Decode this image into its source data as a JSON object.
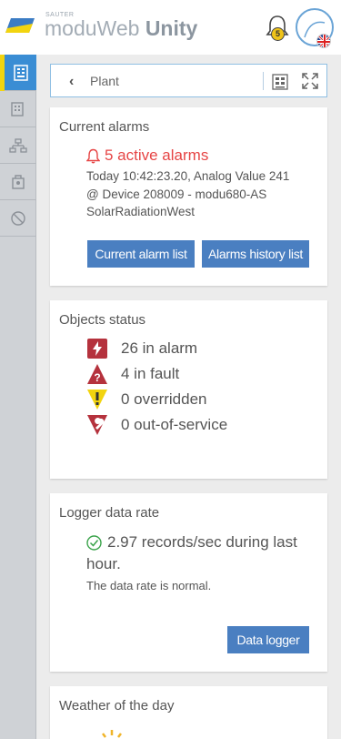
{
  "header": {
    "brand_small": "SAUTER",
    "brand_light": "moduWeb",
    "brand_bold": "Unity",
    "notification_count": "5",
    "colors": {
      "accent": "#3a8dd4",
      "badge": "#f0c419"
    }
  },
  "sidebar": {
    "items": [
      {
        "icon": "building-list-icon",
        "active": true
      },
      {
        "icon": "building-objects-icon"
      },
      {
        "icon": "hierarchy-icon"
      },
      {
        "icon": "device-icon"
      },
      {
        "icon": "disabled-objects-icon"
      }
    ]
  },
  "breadcrumb": {
    "label": "Plant"
  },
  "current_alarms": {
    "title": "Current alarms",
    "active_count_text": "5 active alarms",
    "detail_line1": "Today 10:42:23.20, Analog Value 241",
    "detail_line2": "@ Device 208009 - modu680-AS",
    "detail_line3": "SolarRadiationWest",
    "btn_current": "Current alarm list",
    "btn_history": "Alarms history list"
  },
  "objects_status": {
    "title": "Objects status",
    "rows": [
      {
        "text": "26 in alarm",
        "icon": "alarm-bolt-icon"
      },
      {
        "text": "4 in fault",
        "icon": "fault-question-icon"
      },
      {
        "text": "0 overridden",
        "icon": "overridden-exclamation-icon"
      },
      {
        "text": "0 out-of-service",
        "icon": "out-of-service-wrench-icon"
      }
    ]
  },
  "logger": {
    "title": "Logger data rate",
    "rate_text": "2.97 records/sec during last hour.",
    "status_text": "The data rate is normal.",
    "btn_label": "Data logger"
  },
  "weather": {
    "title": "Weather of the day"
  }
}
